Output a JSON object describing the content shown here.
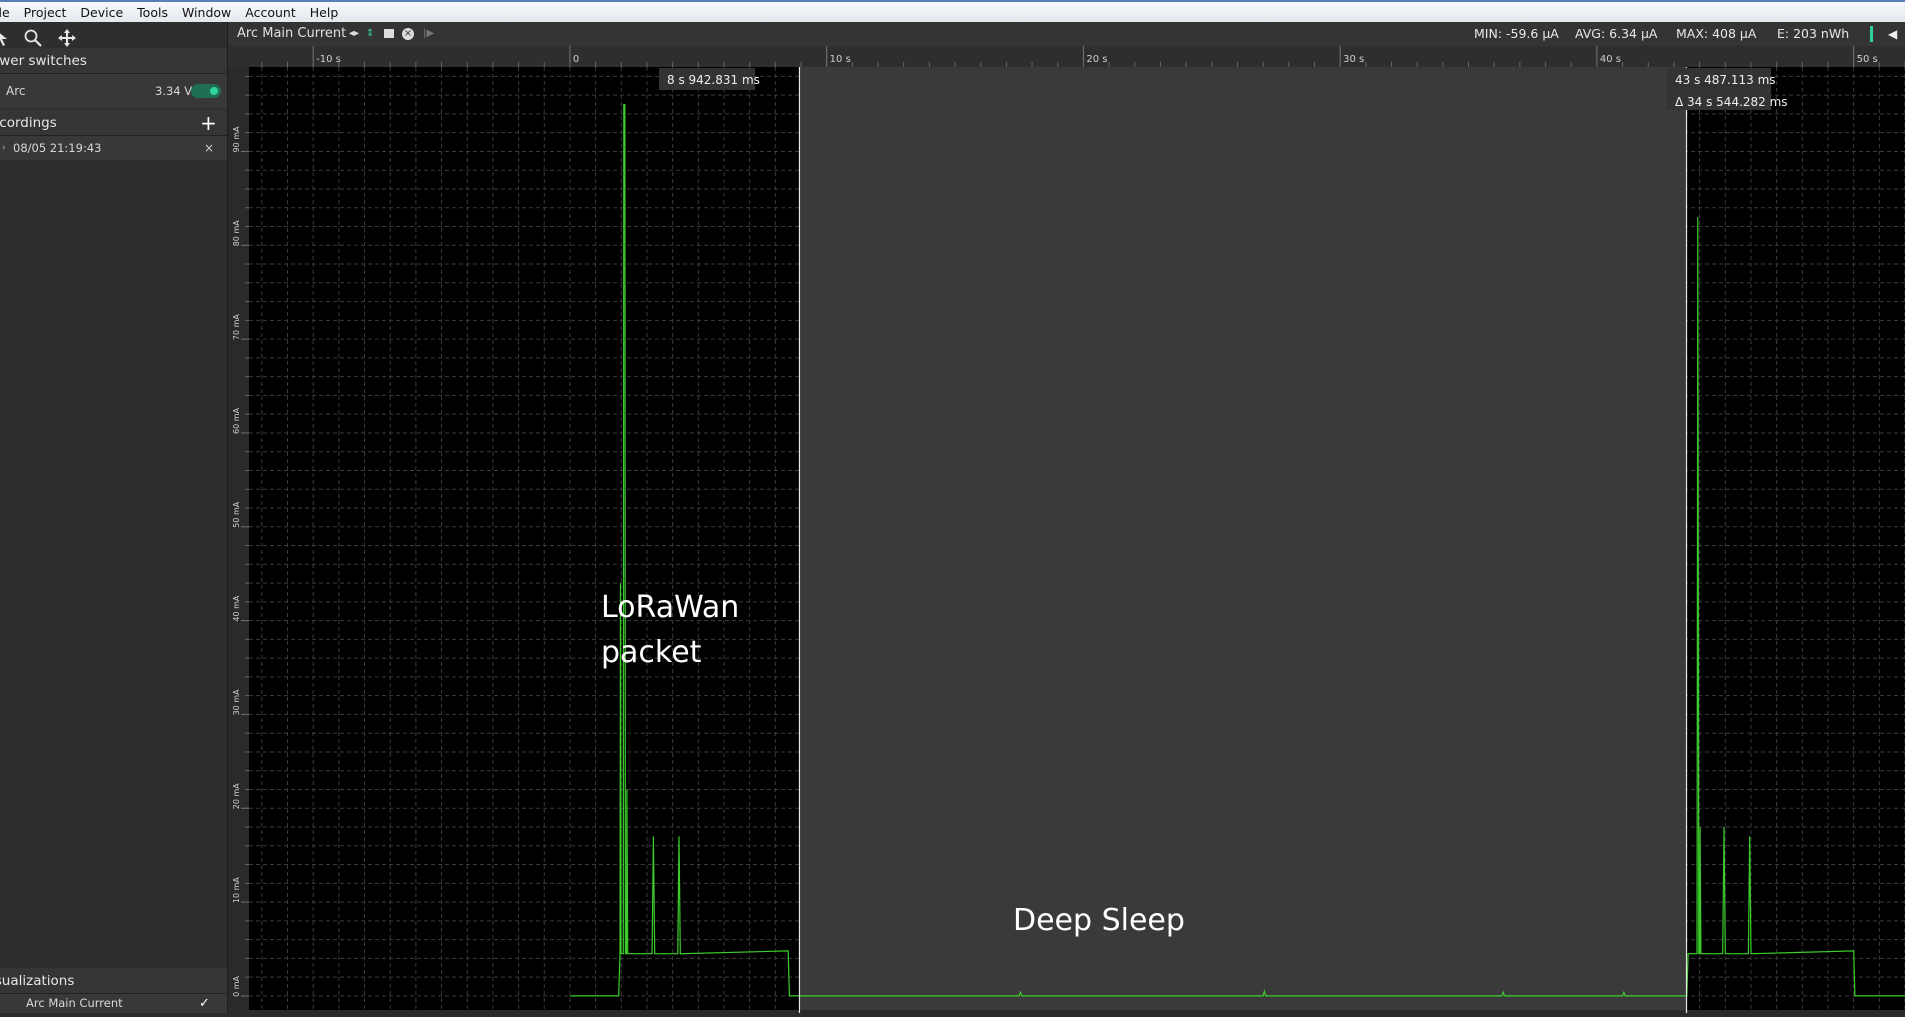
{
  "menu": [
    "ile",
    "Project",
    "Device",
    "Tools",
    "Window",
    "Account",
    "Help"
  ],
  "sidebar": {
    "power_title": "ower switches",
    "power_item": {
      "name": "Arc",
      "voltage": "3.34 V"
    },
    "recordings_title": "ecordings",
    "recording": {
      "name": "08/05 21:19:43"
    },
    "visualizations_title": "isualizations",
    "visualization_item": "Arc Main Current"
  },
  "toolbar": {
    "channel": "Arc Main Current",
    "stats": {
      "min": "MIN: -59.6 µA",
      "avg": "AVG: 6.34 µA",
      "max": "MAX: 408 µA",
      "energy": "E: 203 nWh"
    }
  },
  "plot": {
    "cursor_a_label": "8 s 942.831 ms",
    "cursor_b_label": "43 s 487.113 ms",
    "delta_label": "Δ 34 s 544.282 ms",
    "annotation_lora_line1": "LoRaWan",
    "annotation_lora_line2": "packet",
    "annotation_sleep": "Deep Sleep",
    "colors": {
      "trace": "#3ccd2c",
      "plot_bg": "#000000",
      "selection_bg": "#3a3a3a",
      "accent": "#2fd39a"
    }
  },
  "chart_data": {
    "type": "line",
    "xlabel": "",
    "ylabel": "",
    "xlim": [
      -12.5,
      52
    ],
    "ylim": [
      -1.5,
      99
    ],
    "x_ticks": [
      "-10 s",
      "0",
      "10 s",
      "20 s",
      "30 s",
      "40 s",
      "50 s"
    ],
    "y_ticks": [
      "0 mA",
      "10 mA",
      "20 mA",
      "30 mA",
      "40 mA",
      "50 mA",
      "60 mA",
      "70 mA",
      "80 mA",
      "90 mA"
    ],
    "series": [
      {
        "points": [
          [
            0,
            0
          ],
          [
            1.9,
            0
          ],
          [
            1.95,
            4.5
          ],
          [
            1.97,
            44
          ],
          [
            1.99,
            4.5
          ],
          [
            2.08,
            4.5
          ],
          [
            2.1,
            95
          ],
          [
            2.14,
            95
          ],
          [
            2.16,
            4.5
          ],
          [
            2.2,
            4.5
          ],
          [
            2.22,
            22
          ],
          [
            2.25,
            4.5
          ],
          [
            3.2,
            4.5
          ],
          [
            3.25,
            17
          ],
          [
            3.3,
            4.5
          ],
          [
            4.2,
            4.5
          ],
          [
            4.25,
            17
          ],
          [
            4.3,
            4.5
          ],
          [
            8.5,
            4.8
          ],
          [
            8.55,
            0
          ],
          [
            17.5,
            0
          ],
          [
            17.55,
            0.4
          ],
          [
            17.6,
            0
          ],
          [
            27,
            0
          ],
          [
            27.05,
            0.5
          ],
          [
            27.1,
            0
          ],
          [
            36.3,
            0
          ],
          [
            36.35,
            0.4
          ],
          [
            36.4,
            0
          ],
          [
            41,
            0
          ],
          [
            41.05,
            0.4
          ],
          [
            41.1,
            0
          ],
          [
            43.5,
            0
          ],
          [
            43.55,
            4.5
          ],
          [
            43.9,
            4.5
          ],
          [
            43.93,
            83
          ],
          [
            43.97,
            4.5
          ],
          [
            44,
            4.5
          ],
          [
            44.02,
            18
          ],
          [
            44.05,
            4.5
          ],
          [
            44.9,
            4.5
          ],
          [
            44.95,
            18
          ],
          [
            45,
            4.5
          ],
          [
            45.9,
            4.5
          ],
          [
            45.95,
            17
          ],
          [
            46,
            4.5
          ],
          [
            50,
            4.8
          ],
          [
            50.05,
            0
          ],
          [
            52,
            0
          ]
        ]
      }
    ],
    "cursors": [
      8.94,
      43.49
    ]
  }
}
